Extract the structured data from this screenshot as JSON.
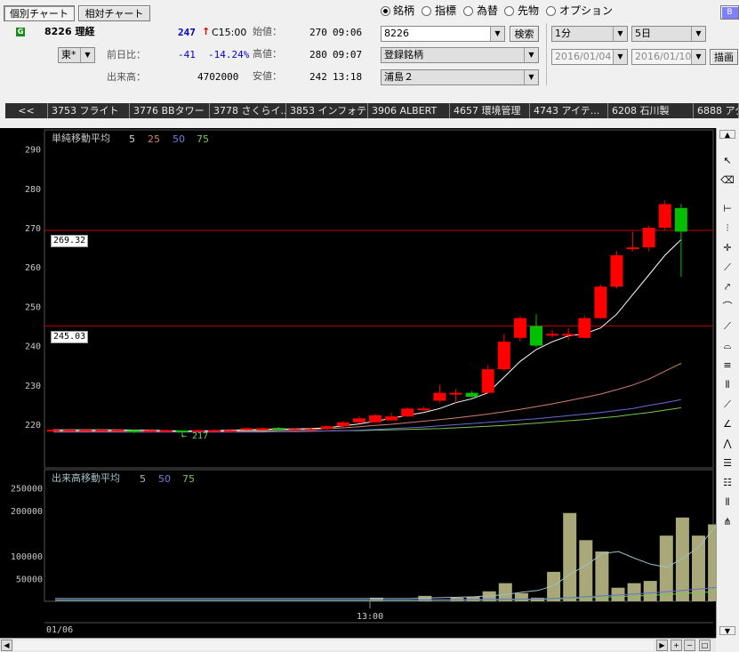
{
  "header": {
    "tab_individual": "個別チャート",
    "tab_relative": "相対チャート",
    "g_badge": "G",
    "stock_code_name": "8226 理経",
    "price": "247",
    "price_arrow": "↑",
    "price_time": "C15:00",
    "exchange": "東*",
    "change_label": "前日比：",
    "change_value": "-41",
    "change_pct": "-14.24%",
    "volume_label": "出来高：",
    "volume_value": "4702000",
    "open_label": "始値：",
    "open_value": "270",
    "open_time": "09:06",
    "high_label": "高値：",
    "high_value": "280",
    "high_time": "09:07",
    "low_label": "安値：",
    "low_value": "242",
    "low_time": "13:18"
  },
  "controls": {
    "radios": [
      {
        "label": "銘柄",
        "selected": true
      },
      {
        "label": "指標",
        "selected": false
      },
      {
        "label": "為替",
        "selected": false
      },
      {
        "label": "先物",
        "selected": false
      },
      {
        "label": "オプション",
        "selected": false
      }
    ],
    "code_input": "8226",
    "search_button": "検索",
    "registered": "登録銘柄",
    "list_name": "浦島２",
    "interval": "1分",
    "period": "5日",
    "date_from": "2016/01/04",
    "date_to": "2016/01/10",
    "draw_button": "描画",
    "corner_button": "B"
  },
  "tabs": [
    "<<",
    "3753 フライト",
    "3776 BBタワー",
    "3778 さくらイ...",
    "3853 インフォテリ",
    "3906 ALBERT",
    "4657 環境管理",
    "4743 アイテ...",
    "6208 石川製",
    "6888 アク"
  ],
  "price_panel": {
    "title": "単純移動平均",
    "ma_labels": [
      "5",
      "25",
      "50",
      "75"
    ],
    "hline_labels": [
      "269.32",
      "245.03"
    ],
    "annotation": "← 217"
  },
  "volume_panel": {
    "title": "出来高移動平均",
    "ma_labels": [
      "5",
      "50",
      "75"
    ]
  },
  "time_axis": {
    "date": "01/06",
    "tick": "13:00"
  },
  "colors": {
    "up": "#ff0000",
    "down": "#00c000",
    "ma5": "#ffffff",
    "ma25": "#d08070",
    "ma50": "#6a6ad8",
    "ma75": "#78c850",
    "hline": "#c00000",
    "volume": "#a8a878"
  },
  "chart_data": [
    {
      "type": "candlestick",
      "title": "単純移動平均",
      "ylim": [
        210,
        292
      ],
      "yticks": [
        220,
        230,
        240,
        250,
        260,
        270,
        280,
        290
      ],
      "xtick_label": "13:00",
      "hlines": [
        269.32,
        245.03
      ],
      "series_labels": [
        "5",
        "25",
        "50",
        "75"
      ],
      "candles": [
        {
          "o": 218.6,
          "c": 218.6,
          "h": 218.9,
          "l": 218.3
        },
        {
          "o": 218.6,
          "c": 218.6,
          "h": 218.8,
          "l": 218.4
        },
        {
          "o": 218.6,
          "c": 218.6,
          "h": 218.8,
          "l": 218.4
        },
        {
          "o": 218.6,
          "c": 218.6,
          "h": 218.8,
          "l": 218.4
        },
        {
          "o": 218.6,
          "c": 218.6,
          "h": 218.8,
          "l": 218.4
        },
        {
          "o": 218.5,
          "c": 218.0,
          "h": 218.6,
          "l": 217.8
        },
        {
          "o": 218.5,
          "c": 218.5,
          "h": 218.7,
          "l": 218.3
        },
        {
          "o": 218.5,
          "c": 218.5,
          "h": 218.7,
          "l": 218.3
        },
        {
          "o": 218.4,
          "c": 218.1,
          "h": 218.5,
          "l": 217.0
        },
        {
          "o": 218.5,
          "c": 218.5,
          "h": 218.7,
          "l": 218.3
        },
        {
          "o": 218.5,
          "c": 218.5,
          "h": 218.7,
          "l": 218.3
        },
        {
          "o": 218.5,
          "c": 218.5,
          "h": 218.7,
          "l": 218.3
        },
        {
          "o": 218.6,
          "c": 219.0,
          "h": 219.2,
          "l": 218.4
        },
        {
          "o": 218.8,
          "c": 219.0,
          "h": 219.2,
          "l": 218.6
        },
        {
          "o": 219.1,
          "c": 218.8,
          "h": 219.3,
          "l": 218.6
        },
        {
          "o": 218.8,
          "c": 218.8,
          "h": 219.0,
          "l": 218.6
        },
        {
          "o": 218.8,
          "c": 218.8,
          "h": 219.0,
          "l": 218.6
        },
        {
          "o": 218.8,
          "c": 219.5,
          "h": 219.8,
          "l": 218.6
        },
        {
          "o": 219.5,
          "c": 220.5,
          "h": 220.8,
          "l": 219.3
        },
        {
          "o": 220.5,
          "c": 221.5,
          "h": 222.0,
          "l": 220.2
        },
        {
          "o": 220.5,
          "c": 222.3,
          "h": 222.6,
          "l": 220.2
        },
        {
          "o": 221.0,
          "c": 222.0,
          "h": 223.0,
          "l": 220.8
        },
        {
          "o": 222.0,
          "c": 224.0,
          "h": 224.3,
          "l": 221.8
        },
        {
          "o": 224.0,
          "c": 224.0,
          "h": 224.5,
          "l": 223.5
        },
        {
          "o": 226.0,
          "c": 228.0,
          "h": 230.0,
          "l": 225.5
        },
        {
          "o": 228.0,
          "c": 228.0,
          "h": 229.0,
          "l": 225.5
        },
        {
          "o": 228.0,
          "c": 227.0,
          "h": 228.5,
          "l": 226.8
        },
        {
          "o": 228.0,
          "c": 234.0,
          "h": 235.0,
          "l": 227.8
        },
        {
          "o": 234.0,
          "c": 241.0,
          "h": 243.0,
          "l": 233.5
        },
        {
          "o": 242.0,
          "c": 247.0,
          "h": 247.5,
          "l": 241.0
        },
        {
          "o": 245.0,
          "c": 240.0,
          "h": 248.0,
          "l": 239.5
        },
        {
          "o": 243.0,
          "c": 243.0,
          "h": 244.0,
          "l": 242.0
        },
        {
          "o": 243.0,
          "c": 243.0,
          "h": 244.5,
          "l": 241.5
        },
        {
          "o": 242.0,
          "c": 247.0,
          "h": 247.5,
          "l": 241.8
        },
        {
          "o": 247.0,
          "c": 255.0,
          "h": 255.5,
          "l": 246.8
        },
        {
          "o": 255.0,
          "c": 263.0,
          "h": 264.0,
          "l": 254.5
        },
        {
          "o": 265.0,
          "c": 265.0,
          "h": 269.0,
          "l": 264.0
        },
        {
          "o": 265.0,
          "c": 270.0,
          "h": 270.5,
          "l": 264.0
        },
        {
          "o": 270.0,
          "c": 276.0,
          "h": 277.0,
          "l": 269.5
        },
        {
          "o": 275.0,
          "c": 269.0,
          "h": 276.0,
          "l": 257.5
        }
      ],
      "ma5": [
        218.6,
        218.6,
        218.6,
        218.6,
        218.6,
        218.5,
        218.5,
        218.4,
        218.3,
        218.3,
        218.4,
        218.5,
        218.6,
        218.7,
        218.8,
        218.8,
        218.9,
        219.1,
        219.6,
        220.1,
        220.8,
        221.5,
        222.3,
        223.0,
        224.0,
        225.5,
        226.5,
        228.0,
        232.0,
        236.0,
        239.0,
        241.0,
        242.5,
        243.0,
        244.5,
        248.0,
        253.0,
        258.0,
        263.0,
        267.0
      ],
      "ma25": [
        218.2,
        218.2,
        218.2,
        218.2,
        218.2,
        218.2,
        218.2,
        218.2,
        218.2,
        218.2,
        218.3,
        218.3,
        218.4,
        218.4,
        218.5,
        218.6,
        218.7,
        218.9,
        219.1,
        219.4,
        219.7,
        220.0,
        220.4,
        220.8,
        221.2,
        221.6,
        222.1,
        222.6,
        223.2,
        223.8,
        224.5,
        225.2,
        226.0,
        226.8,
        227.7,
        228.8,
        230.0,
        231.5,
        233.5,
        235.5
      ],
      "ma50": [
        218.0,
        218.0,
        218.0,
        218.0,
        218.0,
        218.0,
        218.0,
        218.0,
        218.0,
        218.0,
        218.0,
        218.0,
        218.0,
        218.0,
        218.1,
        218.1,
        218.2,
        218.3,
        218.4,
        218.5,
        218.7,
        218.9,
        219.1,
        219.3,
        219.6,
        219.9,
        220.2,
        220.5,
        220.8,
        221.1,
        221.4,
        221.8,
        222.2,
        222.6,
        223.0,
        223.5,
        224.0,
        224.8,
        225.5,
        226.3
      ],
      "ma75": [
        218.3,
        218.3,
        218.3,
        218.3,
        218.3,
        218.2,
        218.2,
        218.2,
        218.2,
        218.2,
        218.2,
        218.2,
        218.2,
        218.2,
        218.2,
        218.2,
        218.3,
        218.3,
        218.4,
        218.4,
        218.5,
        218.6,
        218.7,
        218.8,
        218.9,
        219.1,
        219.3,
        219.5,
        219.7,
        220.0,
        220.3,
        220.6,
        220.9,
        221.2,
        221.6,
        222.0,
        222.5,
        223.0,
        223.6,
        224.2
      ]
    },
    {
      "type": "bar",
      "title": "出来高移動平均",
      "ylim": [
        0,
        275000
      ],
      "yticks": [
        50000,
        100000,
        200000,
        250000
      ],
      "series_labels": [
        "5",
        "50",
        "75"
      ],
      "values": [
        0,
        0,
        0,
        0,
        0,
        0,
        0,
        0,
        0,
        0,
        0,
        0,
        0,
        0,
        0,
        0,
        0,
        0,
        0,
        0,
        8000,
        0,
        0,
        12000,
        0,
        8000,
        10000,
        22000,
        40000,
        18000,
        8000,
        65000,
        195000,
        135000,
        110000,
        30000,
        40000,
        45000,
        145000,
        185000,
        145000,
        170000,
        240000
      ],
      "ma5": [
        6000,
        6000,
        6000,
        6000,
        6000,
        6000,
        6000,
        6000,
        6000,
        6000,
        6000,
        6000,
        6000,
        6000,
        6000,
        6000,
        6000,
        6000,
        6000,
        6000,
        6000,
        6000,
        6000,
        7000,
        8000,
        9000,
        10000,
        12000,
        15000,
        20000,
        24000,
        35000,
        60000,
        80000,
        105000,
        110000,
        95000,
        82000,
        75000,
        95000,
        120000,
        165000,
        210000
      ],
      "ma50": [
        3000,
        3000,
        3000,
        3000,
        3000,
        3000,
        3000,
        3000,
        3000,
        3000,
        3000,
        3000,
        3000,
        3000,
        3000,
        3000,
        3000,
        3000,
        3000,
        3000,
        3000,
        3000,
        3000,
        3200,
        3400,
        3600,
        3800,
        4200,
        4600,
        5000,
        5400,
        6500,
        8000,
        10000,
        12000,
        14000,
        16000,
        18500,
        21000,
        24000,
        27000,
        30500,
        34000
      ],
      "ma75": [
        2000,
        2000,
        2000,
        2000,
        2000,
        2000,
        2000,
        2000,
        2000,
        2000,
        2000,
        2000,
        2000,
        2000,
        2000,
        2000,
        2000,
        2000,
        2000,
        2000,
        2000,
        2000,
        2000,
        2200,
        2400,
        2600,
        2800,
        3000,
        3300,
        3600,
        4000,
        5000,
        6200,
        7600,
        9000,
        10400,
        11800,
        13400,
        15000,
        17000,
        19000,
        21200,
        23500
      ]
    }
  ]
}
